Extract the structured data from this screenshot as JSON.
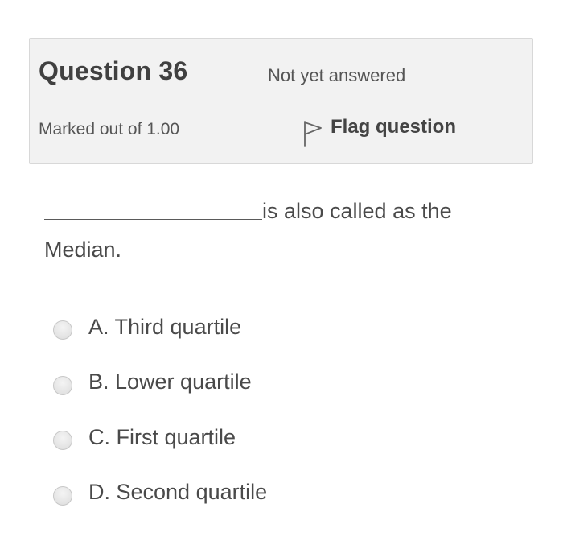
{
  "question": {
    "title": "Question 36",
    "state": "Not yet answered",
    "grade": "Marked out of 1.00",
    "flag_label": "Flag question",
    "flag_icon": "flag-outline-icon"
  },
  "question_text": {
    "blank": "",
    "text": "is also called as the Median."
  },
  "answers": [
    {
      "label": "A. Third quartile",
      "selected": false
    },
    {
      "label": "B. Lower quartile",
      "selected": false
    },
    {
      "label": "C. First quartile",
      "selected": false
    },
    {
      "label": "D. Second quartile",
      "selected": false
    }
  ]
}
